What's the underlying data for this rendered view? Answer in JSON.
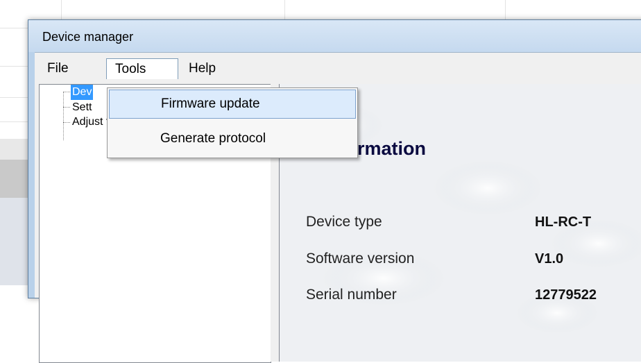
{
  "window": {
    "title": "Device manager"
  },
  "menubar": {
    "items": [
      "File",
      "Tools",
      "Help"
    ],
    "open_index": 1
  },
  "tools_menu": {
    "items": [
      "Firmware update",
      "Generate protocol"
    ],
    "highlighted_index": 0
  },
  "tree": {
    "items": [
      {
        "label": "Device information",
        "visible_text": "Dev",
        "selected": true
      },
      {
        "label": "Settings",
        "visible_text": "Sett",
        "selected": false
      },
      {
        "label": "Adjust temperature",
        "visible_text": "Adjust temperature",
        "selected": false
      }
    ]
  },
  "content": {
    "heading_visible": "e information",
    "rows": [
      {
        "label": "Device type",
        "value": "HL-RC-T"
      },
      {
        "label": "Software version",
        "value": "V1.0"
      },
      {
        "label": "Serial number",
        "value": "12779522"
      }
    ]
  },
  "colors": {
    "selection": "#3399ff",
    "menu_hover": "#dcebfc",
    "window_frame": "#b9d1ea",
    "heading": "#0a0a40"
  }
}
